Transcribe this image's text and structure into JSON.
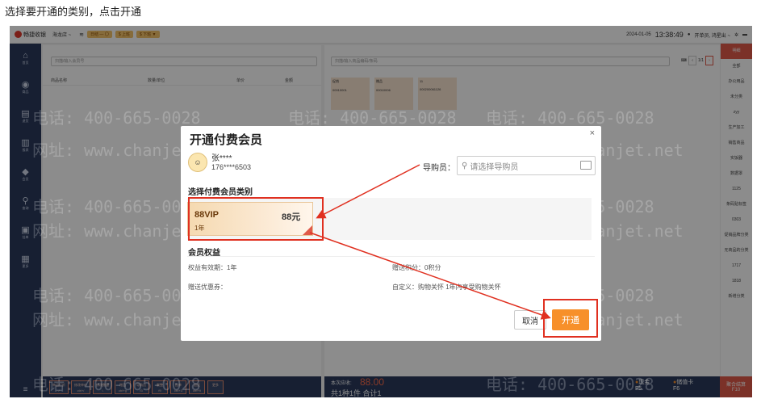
{
  "instruction": "选择要开通的类别，点击开通",
  "topbar": {
    "app_name": "畅捷收银",
    "store": "海龙店 ~",
    "chips": [
      "日结 — 〇",
      "$ 上班",
      "$ 下班 ▼"
    ],
    "date": "2024-01-05",
    "time": "13:38:49",
    "user": "开单员, 鸿星出 ~"
  },
  "sidebar": {
    "items": [
      {
        "icon": "home-icon",
        "glyph": "⌂",
        "label": "首页"
      },
      {
        "icon": "goods-icon",
        "glyph": "◉",
        "label": "商品"
      },
      {
        "icon": "order-icon",
        "glyph": "▤",
        "label": "退货"
      },
      {
        "icon": "report-icon",
        "glyph": "▥",
        "label": "报表"
      },
      {
        "icon": "member-icon",
        "glyph": "◆",
        "label": "会员"
      },
      {
        "icon": "query-icon",
        "glyph": "⚲",
        "label": "查询"
      },
      {
        "icon": "lock-icon",
        "glyph": "▣",
        "label": "挂单"
      },
      {
        "icon": "more-icon",
        "glyph": "▦",
        "label": "更多"
      }
    ],
    "menu": "≡"
  },
  "left_panel": {
    "search_placeholder": "扫描/输入会员号",
    "headers": [
      "商品名称",
      "数量/单位",
      "单价",
      "金额"
    ],
    "tools": [
      {
        "label": "单品打折",
        "key": "/"
      },
      {
        "label": "修改单价",
        "key": "ctrl+/"
      },
      {
        "label": "修改数量",
        "key": "\\"
      },
      {
        "label": "赠品",
        "key": "ctrl+g"
      },
      {
        "label": "导购员",
        "key": "f3"
      },
      {
        "label": "删整",
        "key": "f9"
      },
      {
        "label": "挂单",
        "key": "ctrl+3"
      },
      {
        "label": "退货",
        "key": "ctrl+9"
      },
      {
        "label": "更多",
        "key": ""
      }
    ]
  },
  "mid_panel": {
    "search_placeholder": "扫描/输入商品编码/条码",
    "page": "1/1",
    "products": [
      {
        "name": "促销",
        "code": "00010001"
      },
      {
        "name": "赠品",
        "code": "00010006"
      },
      {
        "name": "11",
        "code": "000200061126"
      }
    ]
  },
  "summary": {
    "label": "本次应收:",
    "amount": "88.00",
    "detail": "共1种1件 合计1",
    "pay1": "现金",
    "pay1_key": "F5",
    "pay2": "储值卡",
    "pay2_key": "F6"
  },
  "right_panel": {
    "categories": [
      "明细",
      "全部",
      "办公用品",
      "未分类",
      "zyy",
      "生产加工",
      "销售商品",
      "实饭器",
      "数据罩",
      "1125",
      "条码贴标签",
      "0303",
      "促销品牌分类",
      "无商品的分类",
      "1717",
      "1818",
      "新增分类"
    ],
    "checkout": "聚合结算",
    "checkout_key": "F10"
  },
  "watermark": {
    "phone": "电话: 400-665-0028",
    "site": "网址: www.chanjet.net"
  },
  "modal": {
    "title": "开通付费会员",
    "close": "×",
    "member_name": "张****",
    "member_phone": "176****6503",
    "guide_label": "导购员：",
    "guide_placeholder": "请选择导购员",
    "category_title": "选择付费会员类别",
    "plan": {
      "name": "88VIP",
      "term": "1年",
      "price": "88元"
    },
    "benefits_title": "会员权益",
    "validity": "权益有效期：1年",
    "points": "赠送积分：0积分",
    "coupons": "赠送优惠券：",
    "custom": "自定义：购物关怀 1年内享受购物关怀",
    "cancel": "取消",
    "open": "开通"
  },
  "colors": {
    "sidebar": "#2a3a5c",
    "accent": "#e05a4a",
    "open_button": "#f7902a",
    "highlight": "#e03020"
  }
}
